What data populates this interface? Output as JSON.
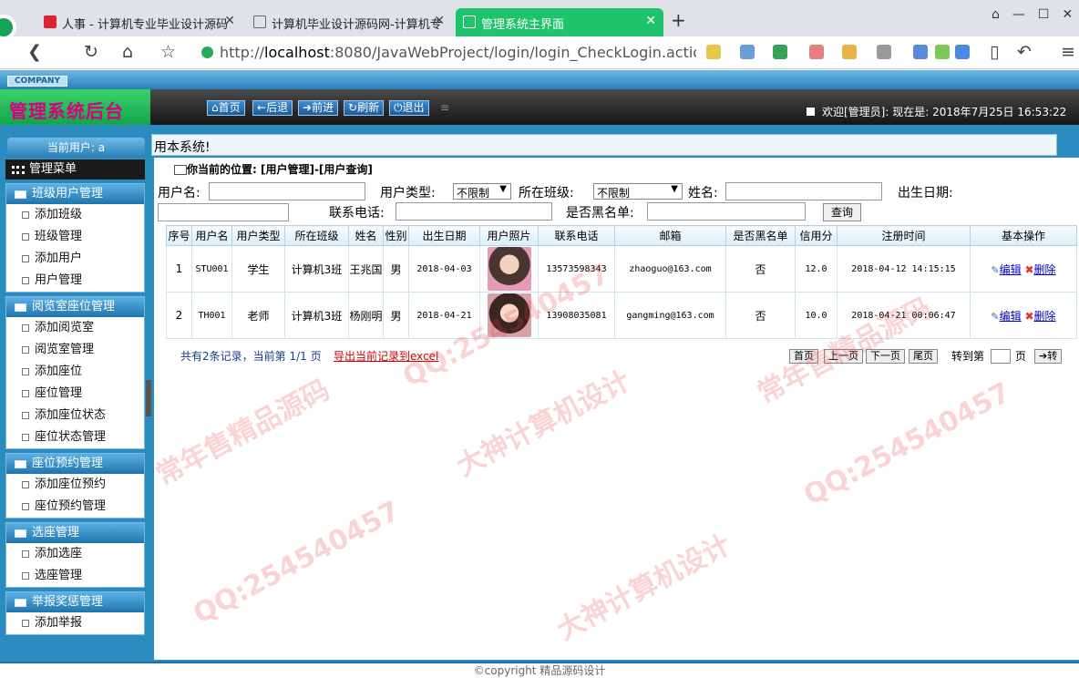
{
  "browser": {
    "tabs": [
      {
        "title": "人事 - 计算机专业毕业设计源码"
      },
      {
        "title": "计算机毕业设计源码网-计算机专"
      },
      {
        "title": "管理系统主界面"
      }
    ],
    "url_prefix": "http://",
    "url_host": "localhost",
    "url_rest": ":8080/JavaWebProject/login/login_CheckLogin.actio"
  },
  "header": {
    "company": "COMPANY",
    "logo": "管理系统后台",
    "nav": [
      "首页",
      "后退",
      "前进",
      "刷新",
      "退出"
    ],
    "welcome": "欢迎[管理员]:",
    "time_label": "现在是: 2018年7月25日 16:53:22"
  },
  "sidebar": {
    "current_user": "当前用户: a",
    "menu_title": "管理菜单",
    "groups": [
      {
        "title": "班级用户管理",
        "items": [
          "添加班级",
          "班级管理",
          "添加用户",
          "用户管理"
        ]
      },
      {
        "title": "阅览室座位管理",
        "items": [
          "添加阅览室",
          "阅览室管理",
          "添加座位",
          "座位管理",
          "添加座位状态",
          "座位状态管理"
        ]
      },
      {
        "title": "座位预约管理",
        "items": [
          "添加座位预约",
          "座位预约管理"
        ]
      },
      {
        "title": "选座管理",
        "items": [
          "添加选座",
          "选座管理"
        ]
      },
      {
        "title": "举报奖惩管理",
        "items": [
          "添加举报"
        ]
      }
    ]
  },
  "system_bar": "用本系统!",
  "breadcrumb": "你当前的位置: [用户管理]-[用户查询]",
  "filters": {
    "username_label": "用户名:",
    "usertype_label": "用户类型:",
    "usertype_value": "不限制",
    "class_label": "所在班级:",
    "class_value": "不限制",
    "name_label": "姓名:",
    "birth_label": "出生日期:",
    "phone_label": "联系电话:",
    "blacklist_label": "是否黑名单:",
    "query_button": "查询"
  },
  "table": {
    "headers": [
      "序号",
      "用户名",
      "用户类型",
      "所在班级",
      "姓名",
      "性别",
      "出生日期",
      "用户照片",
      "联系电话",
      "邮箱",
      "是否黑名单",
      "信用分",
      "注册时间",
      "基本操作"
    ],
    "rows": [
      {
        "no": "1",
        "username": "STU001",
        "type": "学生",
        "cls": "计算机3班",
        "name": "王兆国",
        "sex": "男",
        "birth": "2018-04-03",
        "phone": "13573598343",
        "email": "zhaoguo@163.com",
        "black": "否",
        "credit": "12.0",
        "regtime": "2018-04-12 14:15:15",
        "edit": "编辑",
        "del": "删除"
      },
      {
        "no": "2",
        "username": "TH001",
        "type": "老师",
        "cls": "计算机3班",
        "name": "杨刚明",
        "sex": "男",
        "birth": "2018-04-21",
        "phone": "13908035081",
        "email": "gangming@163.com",
        "black": "否",
        "credit": "10.0",
        "regtime": "2018-04-21 00:06:47",
        "edit": "编辑",
        "del": "删除"
      }
    ]
  },
  "pager": {
    "summary": "共有2条记录，当前第 1/1 页",
    "export": "导出当前记录到excel",
    "first": "首页",
    "prev": "上一页",
    "next": "下一页",
    "last": "尾页",
    "goto_label": "转到第",
    "page_unit": "页",
    "go": "转"
  },
  "footer": "©copyright 精品源码设计",
  "watermarks": [
    "QQ:254540457",
    "常年售精品源码",
    "大神计算机设计"
  ],
  "colors": {
    "accent": "#2b8bbf",
    "logo_bg": "#12a54a",
    "logo_text": "#d60080"
  }
}
